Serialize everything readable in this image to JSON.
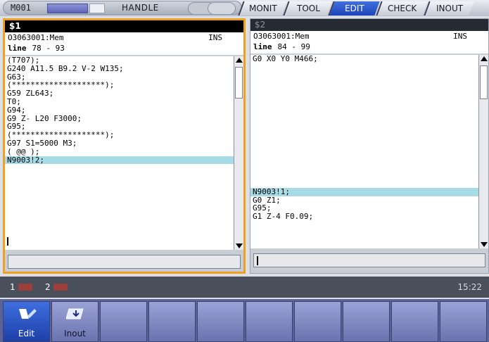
{
  "header": {
    "machine": "M001",
    "mode": "HANDLE",
    "tabs": [
      {
        "label": "MONIT",
        "active": false
      },
      {
        "label": "TOOL",
        "active": false
      },
      {
        "label": "EDIT",
        "active": true
      },
      {
        "label": "CHECK",
        "active": false
      },
      {
        "label": "INOUT",
        "active": false
      }
    ]
  },
  "windows": [
    {
      "title": "$1",
      "program": "O3063001:Mem",
      "edit_mode": "INS",
      "line_label": "line",
      "line_range": "78 - 93",
      "lines": [
        "(T707);",
        "G240 A11.5 B9.2 V-2 W135;",
        "G63;",
        "(********************);",
        "G59 ZL643;",
        "T0;",
        "G94;",
        "G9 Z- L20 F3000;",
        "G95;",
        "(********************);",
        "G97 S1=5000 M3;",
        "( @@ );",
        "N9003!2;",
        "",
        "",
        "",
        "",
        ""
      ],
      "highlight_index": 12
    },
    {
      "title": "$2",
      "program": "O3063001:Mem",
      "edit_mode": "INS",
      "line_label": "line",
      "line_range": "84 - 99",
      "lines": [
        "G0 X0 Y0 M466;",
        "",
        "",
        "",
        "",
        "",
        "",
        "",
        "",
        "",
        "",
        "",
        "",
        "",
        "",
        "",
        "N9003!1;",
        "G0 Z1;",
        "G95;",
        "G1 Z-4 F0.09;"
      ],
      "highlight_index": 16
    }
  ],
  "status": {
    "channel1": "1",
    "channel2": "2",
    "time": "15:22"
  },
  "menu": {
    "keys": [
      {
        "label": "Edit",
        "selected": true,
        "icon": "edit-icon"
      },
      {
        "label": "Inout",
        "selected": false,
        "icon": "inout-icon"
      },
      {
        "label": "",
        "selected": false
      },
      {
        "label": "",
        "selected": false
      },
      {
        "label": "",
        "selected": false
      },
      {
        "label": "",
        "selected": false
      },
      {
        "label": "",
        "selected": false
      },
      {
        "label": "",
        "selected": false
      },
      {
        "label": "",
        "selected": false
      },
      {
        "label": "",
        "selected": false
      }
    ]
  },
  "colors": {
    "active_window_border": "#f0a020",
    "highlight_line": "#a7dbe5",
    "active_tab": "#2b55cc"
  }
}
